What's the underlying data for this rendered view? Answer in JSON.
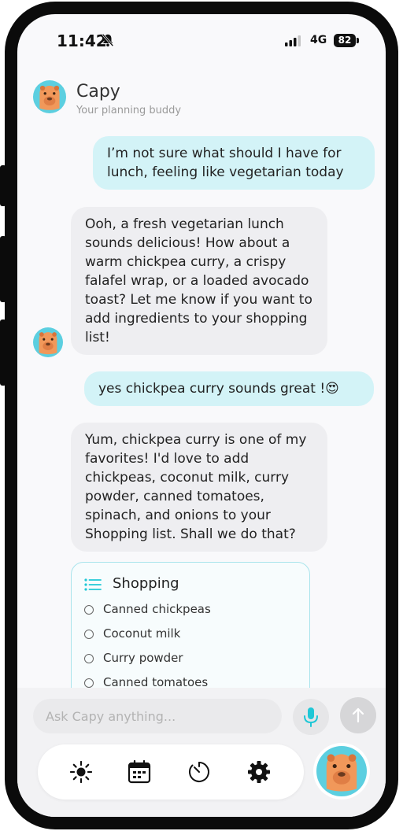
{
  "status_bar": {
    "time": "11:42",
    "network": "4G",
    "battery": "82"
  },
  "header": {
    "name": "Capy",
    "subtitle": "Your planning buddy"
  },
  "messages": [
    {
      "role": "user",
      "text": "I’m not sure what should I have for lunch, feeling like vegetarian today"
    },
    {
      "role": "bot",
      "text": "Ooh, a fresh vegetarian lunch sounds delicious! How about a warm chickpea curry, a crispy falafel wrap, or a loaded avocado toast? Let me know if you want to add ingredients to your shopping list!"
    },
    {
      "role": "user",
      "text": "yes chickpea curry sounds great !😍"
    },
    {
      "role": "bot",
      "text": "Yum, chickpea curry is one of my favorites! I'd love to add chickpeas, coconut milk, curry powder, canned tomatoes, spinach, and onions to your Shopping list. Shall we do that?"
    }
  ],
  "shopping_card": {
    "title": "Shopping",
    "items": [
      "Canned chickpeas",
      "Coconut milk",
      "Curry powder",
      "Canned tomatoes"
    ]
  },
  "input": {
    "placeholder": "Ask Capy anything..."
  },
  "nav": {
    "icons": [
      "sun-icon",
      "calendar-icon",
      "timer-icon",
      "gear-icon"
    ]
  },
  "colors": {
    "accent": "#1fc7d6",
    "user_bubble": "#d3f3f7",
    "bot_bubble": "#eeeef1",
    "avatar_bg": "#5ccfe0",
    "capybara": "#f1985a"
  }
}
